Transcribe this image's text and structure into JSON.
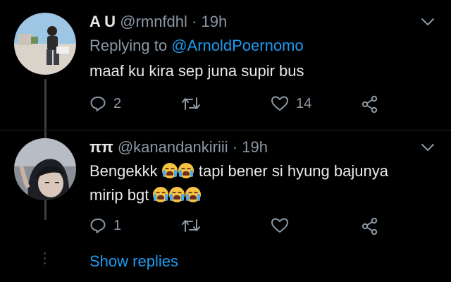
{
  "tweet1": {
    "display_name": "A U",
    "handle": "@rmnfdhl",
    "separator": "·",
    "time": "19h",
    "replying_prefix": "Replying to",
    "replying_to": "@ArnoldPoernomo",
    "text": "maaf ku kira sep juna supir bus",
    "reply_count": "2",
    "retweet_count": "",
    "like_count": "14"
  },
  "tweet2": {
    "display_name": "ππ",
    "handle": "@kanandankiriii",
    "separator": "·",
    "time": "19h",
    "text_line1_a": "Bengekkk",
    "text_line1_b": "tapi bener si hyung bajunya",
    "text_line2": "mirip bgt",
    "reply_count": "1",
    "retweet_count": "",
    "like_count": ""
  },
  "show_replies_label": "Show replies",
  "icons": {
    "reply": "reply-icon",
    "retweet": "retweet-icon",
    "like": "heart-icon",
    "share": "share-icon",
    "more": "chevron-down-icon",
    "emoji": "loudly-crying-face-emoji"
  },
  "colors": {
    "background": "#000000",
    "text": "#e7e9ea",
    "muted": "#8b98a5",
    "accent": "#1d9bf0",
    "thread_line": "#3a3f44"
  }
}
